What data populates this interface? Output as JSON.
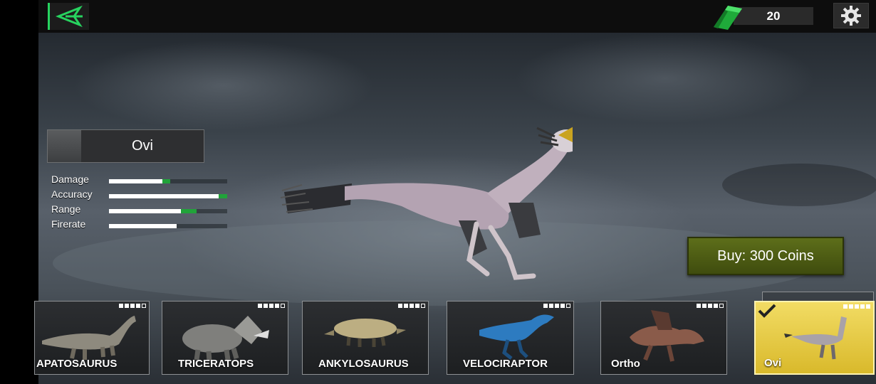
{
  "topbar": {
    "back_icon": "back-arrow-icon",
    "coins": "20",
    "coin_icon": "green-gem-icon",
    "settings_icon": "gear-icon"
  },
  "dino_panel": {
    "name": "Ovi",
    "stats": [
      {
        "label": "Damage",
        "base": 0.45,
        "bonus": 0.07
      },
      {
        "label": "Accuracy",
        "base": 0.93,
        "bonus": 0.07
      },
      {
        "label": "Range",
        "base": 0.61,
        "bonus": 0.13
      },
      {
        "label": "Firerate",
        "base": 0.57,
        "bonus": 0.0
      }
    ]
  },
  "buy_button": "Buy: 300 Coins",
  "cards": [
    {
      "name": "APATOSAURUS",
      "stars": 4,
      "selected": false
    },
    {
      "name": "TRICERATOPS",
      "stars": 4,
      "selected": false
    },
    {
      "name": "ANKYLOSAURUS",
      "stars": 4,
      "selected": false
    },
    {
      "name": "VELOCIRAPTOR",
      "stars": 4,
      "selected": false
    },
    {
      "name": "Ortho",
      "stars": 4,
      "selected": false
    },
    {
      "name": "Ovi",
      "stars": 5,
      "selected": true
    }
  ],
  "colors": {
    "accent_green": "#27d35f",
    "buy_button": "#5d6e1a",
    "selected_card": "#f2dc64"
  }
}
